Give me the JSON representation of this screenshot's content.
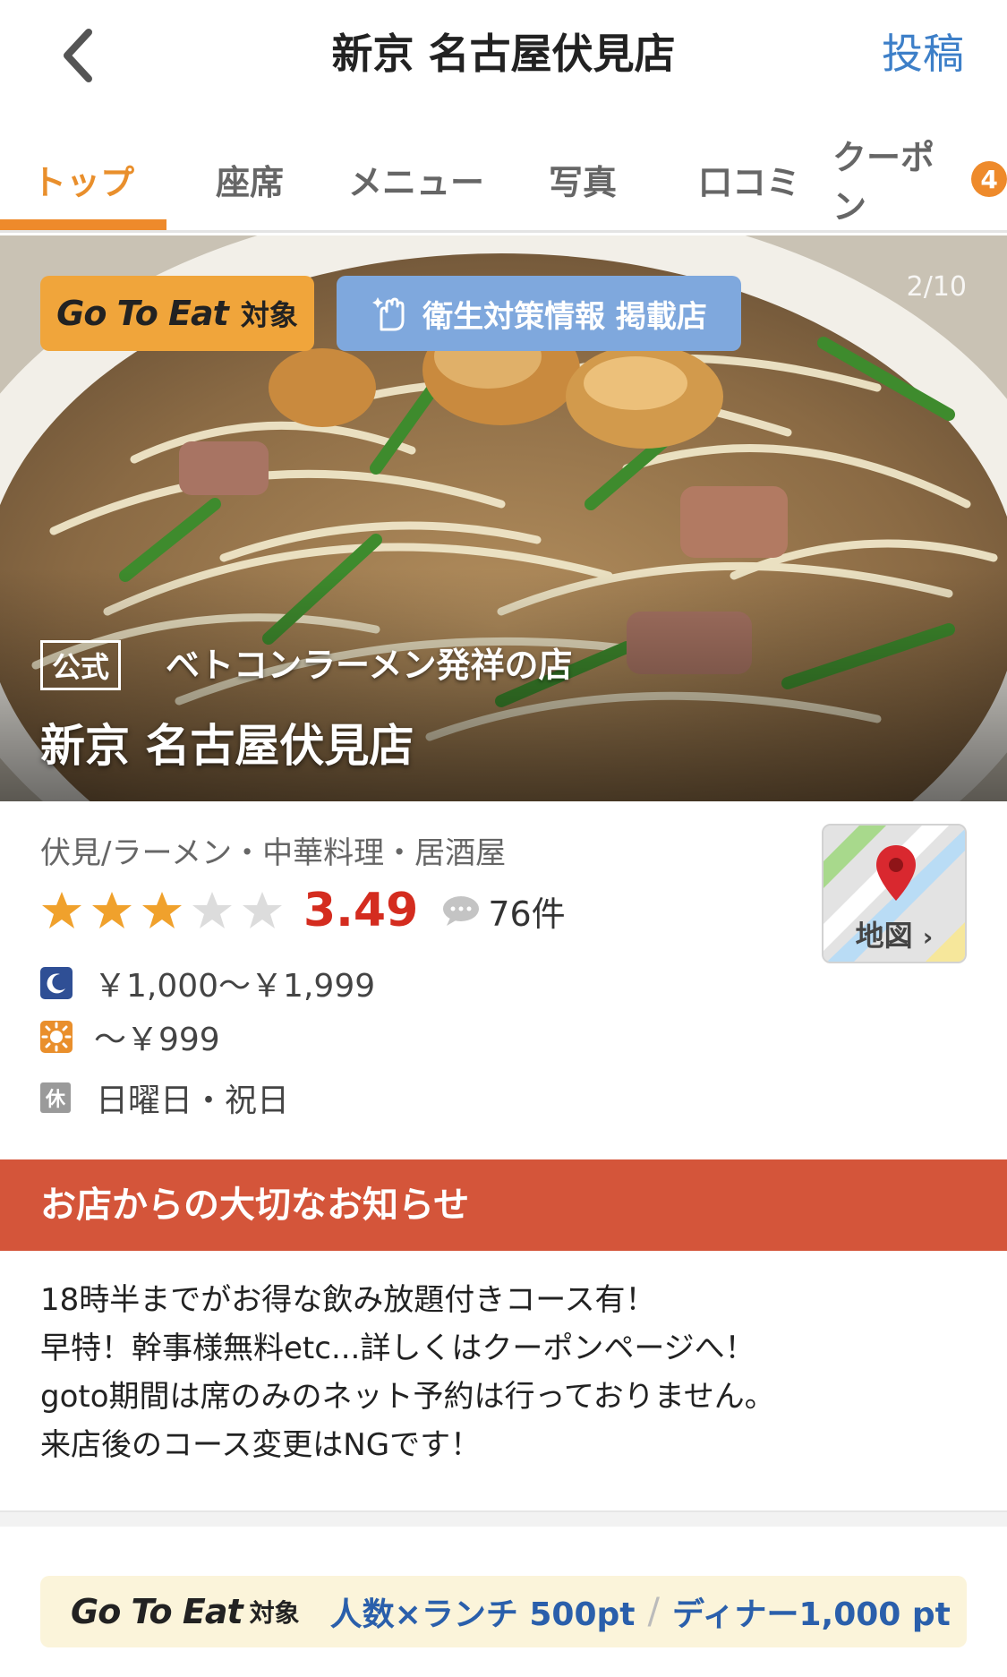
{
  "header": {
    "back_icon": "chevron-left-icon",
    "title": "新京 名古屋伏見店",
    "post_label": "投稿"
  },
  "tabs": [
    {
      "label": "トップ",
      "active": true
    },
    {
      "label": "座席",
      "active": false
    },
    {
      "label": "メニュー",
      "active": false
    },
    {
      "label": "写真",
      "active": false
    },
    {
      "label": "口コミ",
      "active": false
    },
    {
      "label": "クーポン",
      "active": false,
      "badge": "4"
    }
  ],
  "hero": {
    "gotoeat_badge": {
      "brand": "Go To Eat",
      "suffix": "対象"
    },
    "hygiene_badge": {
      "label": "衛生対策情報 掲載店",
      "icon": "hand-sparkle-icon"
    },
    "photo_counter": "2/10",
    "official_label": "公式",
    "tagline": "ベトコンラーメン発祥の店",
    "restaurant_name": "新京 名古屋伏見店"
  },
  "info": {
    "genre": "伏見/ラーメン・中華料理・居酒屋",
    "rating": {
      "stars_filled": 3,
      "stars_total": 5,
      "score": "3.49"
    },
    "reviews": {
      "icon": "speech-bubble-icon",
      "count": "76件"
    },
    "dinner_price": {
      "icon": "moon-icon",
      "text": "￥1,000～￥1,999"
    },
    "lunch_price": {
      "icon": "sun-icon",
      "text": "～￥999"
    },
    "closed_days": {
      "icon_label": "休",
      "text": "日曜日・祝日"
    },
    "map": {
      "label": "地図",
      "icon": "map-pin-icon"
    }
  },
  "notice": {
    "title": "お店からの大切なお知らせ",
    "lines": [
      "18時半までがお得な飲み放題付きコース有！",
      "早特！幹事様無料etc...詳しくはクーポンページへ！",
      "goto期間は席のみのネット予約は行っておりません。",
      "来店後のコース変更はNGです！"
    ]
  },
  "bottom_banner": {
    "brand": "Go To Eat",
    "suffix": "対象",
    "lunch_text": "人数×ランチ 500pt",
    "separator": "/",
    "dinner_text": "ディナー1,000 pt"
  },
  "colors": {
    "accent_orange": "#ee8a2b",
    "link_blue": "#3d7fc8",
    "rating_red": "#d42c1f",
    "notice_red": "#d4553a",
    "hygiene_blue": "#7fa8dd",
    "gotoeat_orange": "#f0a53b"
  }
}
